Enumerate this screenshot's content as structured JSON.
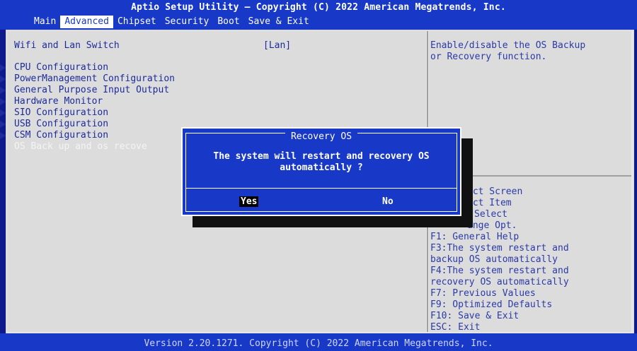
{
  "header": {
    "title": "Aptio Setup Utility – Copyright (C) 2022 American Megatrends, Inc.",
    "tabs": [
      "Main",
      "Advanced",
      "Chipset",
      "Security",
      "Boot",
      "Save & Exit"
    ],
    "active_tab": "Advanced"
  },
  "settings": {
    "wifi_lan_label": "Wifi and Lan Switch",
    "wifi_lan_value": "[Lan]"
  },
  "menu": [
    "CPU Configuration",
    "PowerManagement Configuration",
    "General Purpose Input Output",
    "Hardware Monitor",
    "SIO Configuration",
    "USB Configuration",
    "CSM Configuration"
  ],
  "disabled_item": "OS Back up and os recove",
  "help": {
    "description": "Enable/disable the OS Backup\nor Recovery function."
  },
  "keys": [
    "ect Screen",
    "ect Item",
    "Select",
    "ange Opt.",
    "F1: General Help",
    "F3:The system restart and",
    "backup OS automatically",
    "F4:The system restart and",
    "recovery OS automatically",
    "F7: Previous Values",
    "F9: Optimized Defaults",
    "F10: Save & Exit",
    "ESC: Exit"
  ],
  "dialog": {
    "title": "Recovery OS",
    "message_line1": "The system will restart and recovery OS",
    "message_line2": "automatically ?",
    "yes": "Yes",
    "no": "No"
  },
  "footer": {
    "text": "Version 2.20.1271. Copyright (C) 2022 American Megatrends, Inc."
  },
  "colors": {
    "header_bg": "#1838c8",
    "pane_bg": "#dcdcdc",
    "text_blue": "#1c2c9c"
  }
}
